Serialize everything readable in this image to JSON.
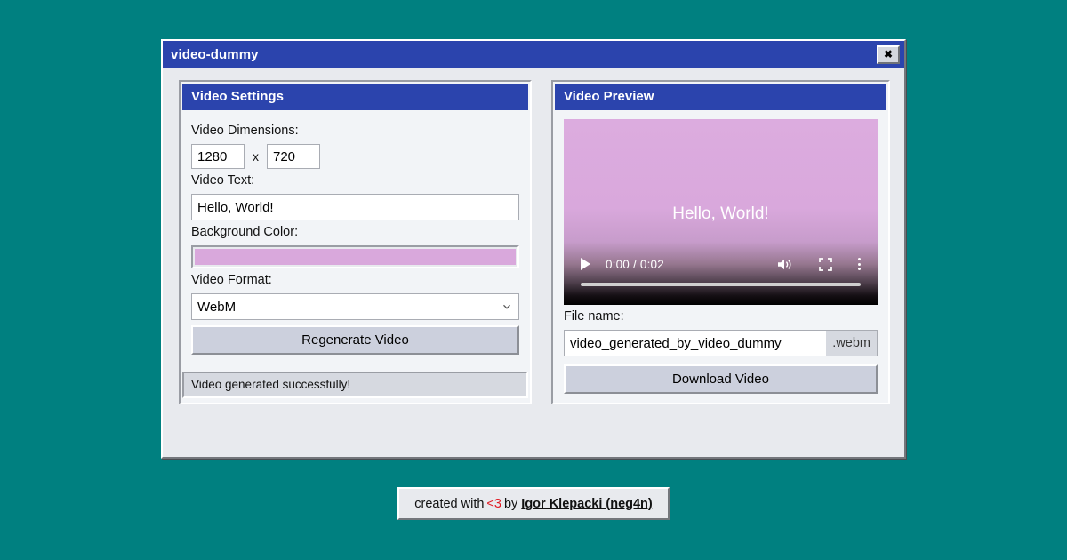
{
  "window": {
    "title": "video-dummy",
    "close_label": "✖"
  },
  "settings_panel": {
    "header": "Video Settings",
    "dimensions_label": "Video Dimensions:",
    "width_value": "1280",
    "height_value": "720",
    "dimensions_separator": "x",
    "text_label": "Video Text:",
    "text_value": "Hello, World!",
    "background_label": "Background Color:",
    "background_color": "#d9a8dc",
    "format_label": "Video Format:",
    "format_value": "WebM",
    "format_options": [
      "WebM"
    ],
    "regenerate_label": "Regenerate Video",
    "status_message": "Video generated successfully!"
  },
  "preview_panel": {
    "header": "Video Preview",
    "video_overlay_text": "Hello, World!",
    "video_background_color": "#d9a8dc",
    "player": {
      "current_time": "0:00",
      "duration": "0:02",
      "time_display": "0:00 / 0:02",
      "play_icon": "play-icon",
      "volume_icon": "volume-icon",
      "fullscreen_icon": "fullscreen-icon",
      "more_icon": "more-options-icon"
    },
    "filename_label": "File name:",
    "filename_value": "video_generated_by_video_dummy",
    "file_extension": ".webm",
    "download_label": "Download Video"
  },
  "footer": {
    "prefix": "created with",
    "heart": "<3",
    "middle": "by",
    "author": "Igor Klepacki (neg4n)"
  },
  "colors": {
    "desktop_background": "#008080",
    "titlebar_blue": "#2b44ad",
    "panel_header_blue": "#2b44ad",
    "heart_red": "#e01b24"
  }
}
